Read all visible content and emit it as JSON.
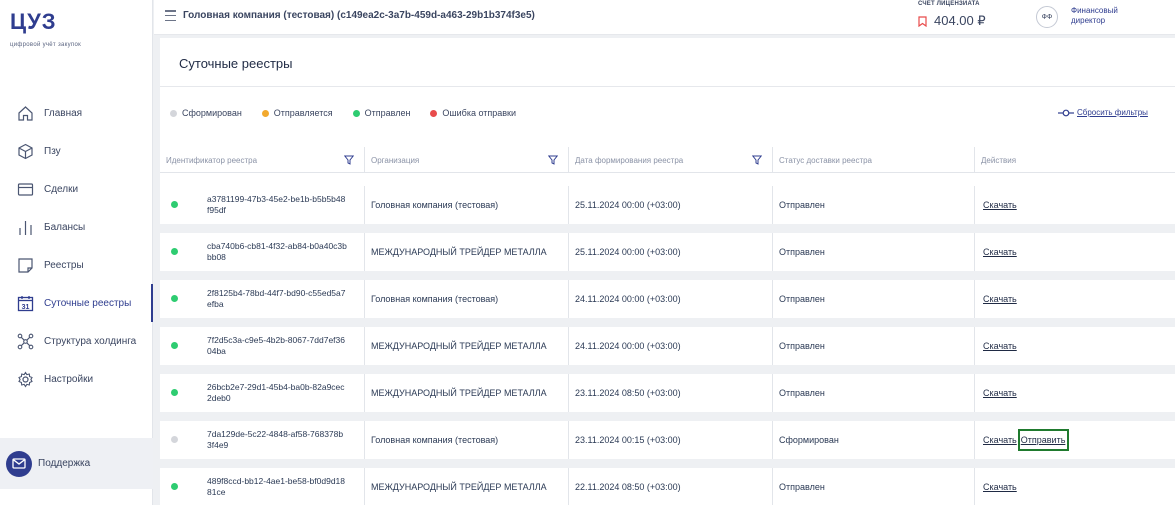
{
  "app": {
    "logo": "ЦУЗ",
    "logo_sub": "цифровой учёт закупок"
  },
  "sidebar": {
    "items": [
      {
        "label": "Главная",
        "icon": "home-icon",
        "active": false
      },
      {
        "label": "Пзу",
        "icon": "cube-icon",
        "active": false
      },
      {
        "label": "Сделки",
        "icon": "deals-icon",
        "active": false
      },
      {
        "label": "Балансы",
        "icon": "bars-icon",
        "active": false
      },
      {
        "label": "Реестры",
        "icon": "note-icon",
        "active": false
      },
      {
        "label": "Суточные реестры",
        "icon": "calendar-31-icon",
        "active": true,
        "badge": "31"
      },
      {
        "label": "Структура холдинга",
        "icon": "structure-icon",
        "active": false
      },
      {
        "label": "Настройки",
        "icon": "gear-icon",
        "active": false
      }
    ],
    "support_label": "Поддержка"
  },
  "topbar": {
    "company": "Головная компания (тестовая) (c149ea2c-3a7b-459d-a463-29b1b374f3e5)",
    "account_label": "СЧЕТ ЛИЦЕНЗИАТА",
    "account_value": "404.00 ₽",
    "avatar_initials": "ФФ",
    "role": "Финансовый директор"
  },
  "page": {
    "title": "Суточные реестры",
    "legend": [
      {
        "label": "Сформирован",
        "color": "#d4d6db"
      },
      {
        "label": "Отправляется",
        "color": "#f2a92e"
      },
      {
        "label": "Отправлен",
        "color": "#2ecc71"
      },
      {
        "label": "Ошибка отправки",
        "color": "#e84b4b"
      }
    ],
    "reset_filters": "Сбросить фильтры"
  },
  "table": {
    "columns": [
      {
        "label": "Идентификатор реестра",
        "filter": true
      },
      {
        "label": "Организация",
        "filter": true
      },
      {
        "label": "Дата формирования реестра",
        "filter": true
      },
      {
        "label": "Статус доставки реестра",
        "filter": false
      },
      {
        "label": "Действия",
        "filter": false
      }
    ],
    "rows": [
      {
        "id": "a3781199-47b3-45e2-be1b-b5b5b48f95df",
        "org": "Головная компания (тестовая)",
        "date": "25.11.2024 00:00 (+03:00)",
        "status": "Отправлен",
        "status_color": "#2ecc71",
        "download": "Скачать",
        "send": ""
      },
      {
        "id": "cba740b6-cb81-4f32-ab84-b0a40c3bbb08",
        "org": "МЕЖДУНАРОДНЫЙ ТРЕЙДЕР МЕТАЛЛА",
        "date": "25.11.2024 00:00 (+03:00)",
        "status": "Отправлен",
        "status_color": "#2ecc71",
        "download": "Скачать",
        "send": ""
      },
      {
        "id": "2f8125b4-78bd-44f7-bd90-c55ed5a7efba",
        "org": "Головная компания (тестовая)",
        "date": "24.11.2024 00:00 (+03:00)",
        "status": "Отправлен",
        "status_color": "#2ecc71",
        "download": "Скачать",
        "send": ""
      },
      {
        "id": "7f2d5c3a-c9e5-4b2b-8067-7dd7ef3604ba",
        "org": "МЕЖДУНАРОДНЫЙ ТРЕЙДЕР МЕТАЛЛА",
        "date": "24.11.2024 00:00 (+03:00)",
        "status": "Отправлен",
        "status_color": "#2ecc71",
        "download": "Скачать",
        "send": ""
      },
      {
        "id": "26bcb2e7-29d1-45b4-ba0b-82a9cec2deb0",
        "org": "МЕЖДУНАРОДНЫЙ ТРЕЙДЕР МЕТАЛЛА",
        "date": "23.11.2024 08:50 (+03:00)",
        "status": "Отправлен",
        "status_color": "#2ecc71",
        "download": "Скачать",
        "send": ""
      },
      {
        "id": "7da129de-5c22-4848-af58-768378b3f4e9",
        "org": "Головная компания (тестовая)",
        "date": "23.11.2024 00:15 (+03:00)",
        "status": "Сформирован",
        "status_color": "#d4d6db",
        "download": "Скачать",
        "send": "Отправить"
      },
      {
        "id": "489f8ccd-bb12-4ae1-be58-bf0d9d1881ce",
        "org": "МЕЖДУНАРОДНЫЙ ТРЕЙДЕР МЕТАЛЛА",
        "date": "22.11.2024 08:50 (+03:00)",
        "status": "Отправлен",
        "status_color": "#2ecc71",
        "download": "Скачать",
        "send": ""
      }
    ]
  }
}
